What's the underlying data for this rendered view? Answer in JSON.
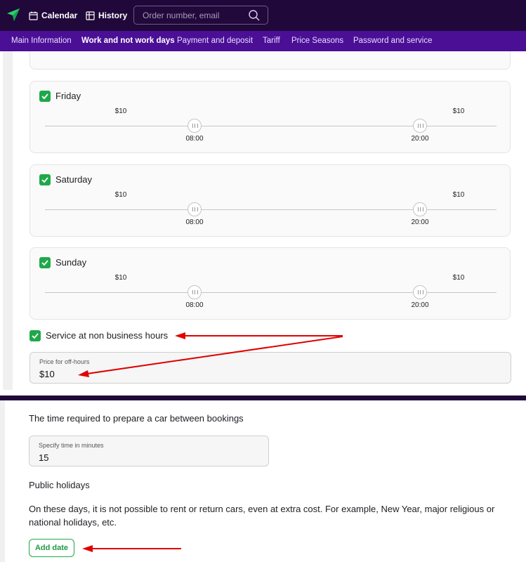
{
  "header": {
    "nav": {
      "calendar": "Calendar",
      "history": "History"
    },
    "search": {
      "placeholder": "Order number, email"
    }
  },
  "tabs": [
    {
      "label": "Main Information",
      "active": false
    },
    {
      "label": "Work and not work days",
      "active": true
    },
    {
      "label": "Payment and deposit",
      "active": false
    },
    {
      "label": "Tariff",
      "active": false
    },
    {
      "label": "Price Seasons",
      "active": false
    },
    {
      "label": "Password and service",
      "active": false
    }
  ],
  "days": [
    {
      "name": "Friday",
      "checked": true,
      "price_start": "$10",
      "price_end": "$10",
      "time_start": "08:00",
      "time_end": "20:00"
    },
    {
      "name": "Saturday",
      "checked": true,
      "price_start": "$10",
      "price_end": "$10",
      "time_start": "08:00",
      "time_end": "20:00"
    },
    {
      "name": "Sunday",
      "checked": true,
      "price_start": "$10",
      "price_end": "$10",
      "time_start": "08:00",
      "time_end": "20:00"
    }
  ],
  "service_non_business": {
    "label": "Service at non business hours",
    "checked": true
  },
  "off_hours": {
    "label": "Price for off-hours",
    "value": "$10"
  },
  "prep": {
    "heading": "The time required to prepare a car between bookings",
    "label": "Specify time in minutes",
    "value": "15"
  },
  "holidays": {
    "heading": "Public holidays",
    "description": "On these days, it is not possible to rent or return cars, even at extra cost. For example, New Year, major religious or national holidays, etc.",
    "add_button": "Add date"
  },
  "colors": {
    "topbar": "#20083a",
    "tabbar": "#4b0f96",
    "accent_green": "#1fa84a",
    "annotation_red": "#e00000"
  }
}
